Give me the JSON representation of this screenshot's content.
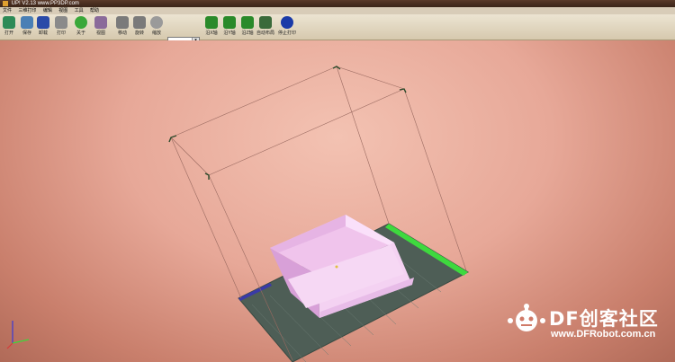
{
  "window": {
    "title": "UP! V2.13 www.PP3DP.com"
  },
  "menu": [
    "文件",
    "三维打印",
    "编辑",
    "视图",
    "工具",
    "帮助"
  ],
  "toolbar": {
    "buttons": [
      {
        "label": "打开",
        "icon": "open-icon",
        "color": "#2e8b57"
      },
      {
        "label": "保存",
        "icon": "save-icon",
        "color": "#4a7fb5"
      },
      {
        "label": "卸载",
        "icon": "unload-icon",
        "color": "#2a4aa8"
      },
      {
        "label": "打印",
        "icon": "print-icon",
        "color": "#8a8a8a"
      },
      {
        "label": "关于",
        "icon": "about-icon",
        "color": "#3aa83a"
      },
      {
        "label": "视图",
        "icon": "view-icon",
        "color": "#8a6a9a"
      },
      {
        "label": "移动",
        "icon": "move-icon",
        "color": "#7a7a7a"
      },
      {
        "label": "旋转",
        "icon": "rotate-icon",
        "color": "#7a7a7a"
      },
      {
        "label": "缩放",
        "icon": "scale-icon",
        "color": "#9a9a9a"
      },
      {
        "label": "沿X轴",
        "icon": "x-axis-icon",
        "color": "#2a8a2a"
      },
      {
        "label": "沿Y轴",
        "icon": "y-axis-icon",
        "color": "#2a8a2a"
      },
      {
        "label": "沿Z轴",
        "icon": "z-axis-icon",
        "color": "#2a8a2a"
      },
      {
        "label": "自动布局",
        "icon": "auto-layout-icon",
        "color": "#3a6a3a"
      },
      {
        "label": "停止打印",
        "icon": "stop-print-icon",
        "color": "#1a3aa8"
      }
    ],
    "combo_value": ""
  },
  "watermark": {
    "title": "DF创客社区",
    "url": "www.DFRobot.com.cn"
  }
}
